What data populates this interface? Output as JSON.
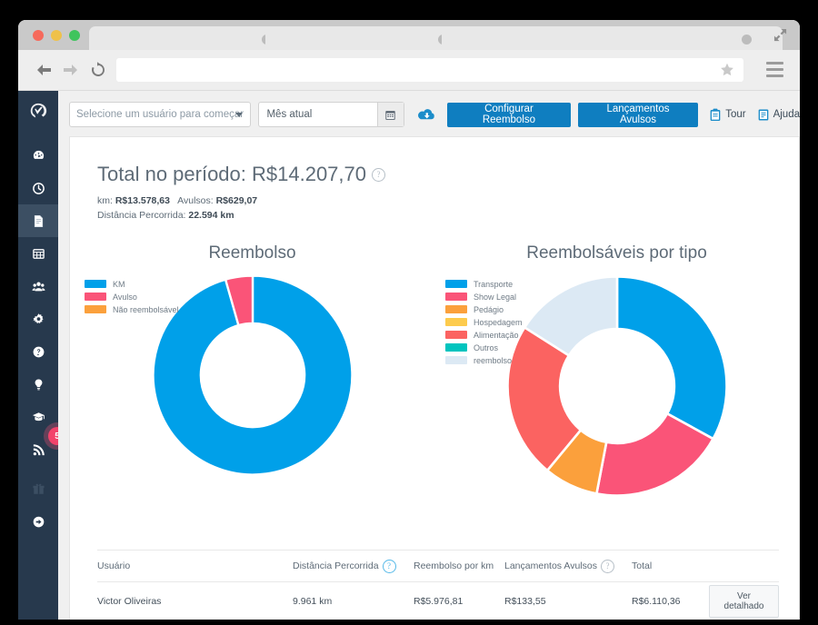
{
  "browser": {
    "window_controls": [
      "close",
      "minimize",
      "maximize"
    ],
    "back_label": "Back",
    "forward_label": "Forward",
    "reload_label": "Reload",
    "url_value": "",
    "url_placeholder": "",
    "bookmark_label": "Bookmark",
    "menu_label": "Menu",
    "fullscreen_label": "Fullscreen"
  },
  "sidebar": {
    "logo_name": "app-logo",
    "items": [
      {
        "name": "dashboard",
        "icon": "gauge-icon",
        "active": false
      },
      {
        "name": "clock",
        "icon": "clock-icon",
        "active": false
      },
      {
        "name": "reports",
        "icon": "document-icon",
        "active": true
      },
      {
        "name": "spreadsheet",
        "icon": "table-icon",
        "active": false
      },
      {
        "name": "team",
        "icon": "people-icon",
        "active": false
      },
      {
        "name": "settings",
        "icon": "gear-icon",
        "active": false
      },
      {
        "name": "help",
        "icon": "question-circle-icon",
        "active": false
      },
      {
        "name": "ideas",
        "icon": "lightbulb-icon",
        "active": false
      },
      {
        "name": "academy",
        "icon": "graduation-cap-icon",
        "active": false
      },
      {
        "name": "news",
        "icon": "rss-icon",
        "active": false,
        "badge": "5"
      },
      {
        "name": "gifts",
        "icon": "gift-icon",
        "active": false
      },
      {
        "name": "logout",
        "icon": "arrow-circle-icon",
        "active": false
      }
    ]
  },
  "toolbar": {
    "user_select_value": "Selecione um usuário para começar",
    "period_value": "Mês atual",
    "calendar_icon": "calendar-icon",
    "download_icon": "cloud-download-icon",
    "configure_label": "Configurar Reembolso",
    "entries_label": "Lançamentos Avulsos",
    "tour_label": "Tour",
    "tour_icon": "clipboard-icon",
    "help_label": "Ajuda",
    "help_icon": "help-document-icon"
  },
  "summary": {
    "title": "Total no período: R$14.207,70",
    "help_icon": "question-mark-icon",
    "km_label": "km:",
    "km_value": "R$13.578,63",
    "avulsos_label": "Avulsos:",
    "avulsos_value": "R$629,07",
    "distance_label": "Distância Percorrida:",
    "distance_value": "22.594 km"
  },
  "chart_data": [
    {
      "type": "pie",
      "title": "Reembolso",
      "categories": [
        "KM",
        "Avulso",
        "Não reembolsável"
      ],
      "values": [
        95.6,
        4.4,
        0
      ],
      "colors": [
        "#00A0E9",
        "#FA5478",
        "#FBA03C"
      ],
      "legend_position": "left",
      "donut": true,
      "start_angle": 0
    },
    {
      "type": "pie",
      "title": "Reembolsáveis por tipo",
      "categories": [
        "Transporte",
        "Show Legal",
        "Pedágio",
        "Hospedagem",
        "Alimentação",
        "Outros",
        "reembolso"
      ],
      "values": [
        33,
        20,
        8,
        0,
        23,
        0,
        16
      ],
      "colors": [
        "#00A0E9",
        "#FA5478",
        "#FBA03C",
        "#FDCB4D",
        "#FB6361",
        "#00C4BE",
        "#DCE9F4"
      ],
      "legend_position": "left",
      "donut": true,
      "start_angle": 0
    }
  ],
  "table": {
    "headers": [
      "Usuário",
      "Distância Percorrida",
      "Reembolso por km",
      "Lançamentos Avulsos",
      "Total",
      ""
    ],
    "header_help_icons": {
      "distancia": "question-mark-icon",
      "lancamentos": "question-mark-icon"
    },
    "rows": [
      {
        "usuario": "Victor Oliveiras",
        "distancia": "9.961 km",
        "reembolso_km": "R$5.976,81",
        "lancamentos": "R$133,55",
        "total": "R$6.110,36",
        "action_label": "Ver detalhado"
      }
    ]
  },
  "colors": {
    "sidebar_bg": "#27394D",
    "sidebar_active": "#3C4F63",
    "primary_button": "#0F7EC0",
    "badge": "#F2436B",
    "accent_blue": "#00A0E9"
  }
}
